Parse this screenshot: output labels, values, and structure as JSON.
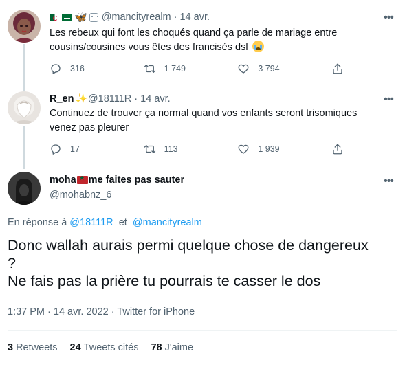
{
  "tweets": [
    {
      "name": "",
      "handle": "@mancityrealm",
      "date": "14 avr.",
      "text": "Les rebeux qui font les choqués quand ça parle de mariage entre cousins/cousines vous êtes des francisés dsl",
      "emoji_after_text": "crying-face-icon",
      "replies": "316",
      "retweets": "1 749",
      "likes": "3 794"
    },
    {
      "name": "R_en",
      "handle": "@18111R",
      "date": "14 avr.",
      "text": "Continuez de trouver ça normal quand vos enfants seront trisomiques venez pas pleurer",
      "replies": "17",
      "retweets": "113",
      "likes": "1 939"
    }
  ],
  "main": {
    "name_start": "moha",
    "name_end": "me faites pas sauter",
    "handle": "@mohabnz_6",
    "reply_prefix": "En réponse à",
    "reply_mention_1": "@18111R",
    "reply_and": "et",
    "reply_mention_2": "@mancityrealm",
    "text_line1": "Donc wallah aurais permi quelque chose de dangereux",
    "text_line2": "?",
    "text_line3": "Ne fais pas la prière tu pourrais te casser le dos",
    "meta": "1:37 PM · 14 avr. 2022 · Twitter for iPhone",
    "stats": {
      "retweets_count": "3",
      "retweets_label": "Retweets",
      "quotes_count": "24",
      "quotes_label": "Tweets cités",
      "likes_count": "78",
      "likes_label": "J'aime"
    }
  },
  "separator": "·",
  "more_glyph": "•••",
  "colors": {
    "accent": "#1d9bf0",
    "muted": "#536471",
    "text": "#0f1419",
    "line": "#cfd9de"
  }
}
